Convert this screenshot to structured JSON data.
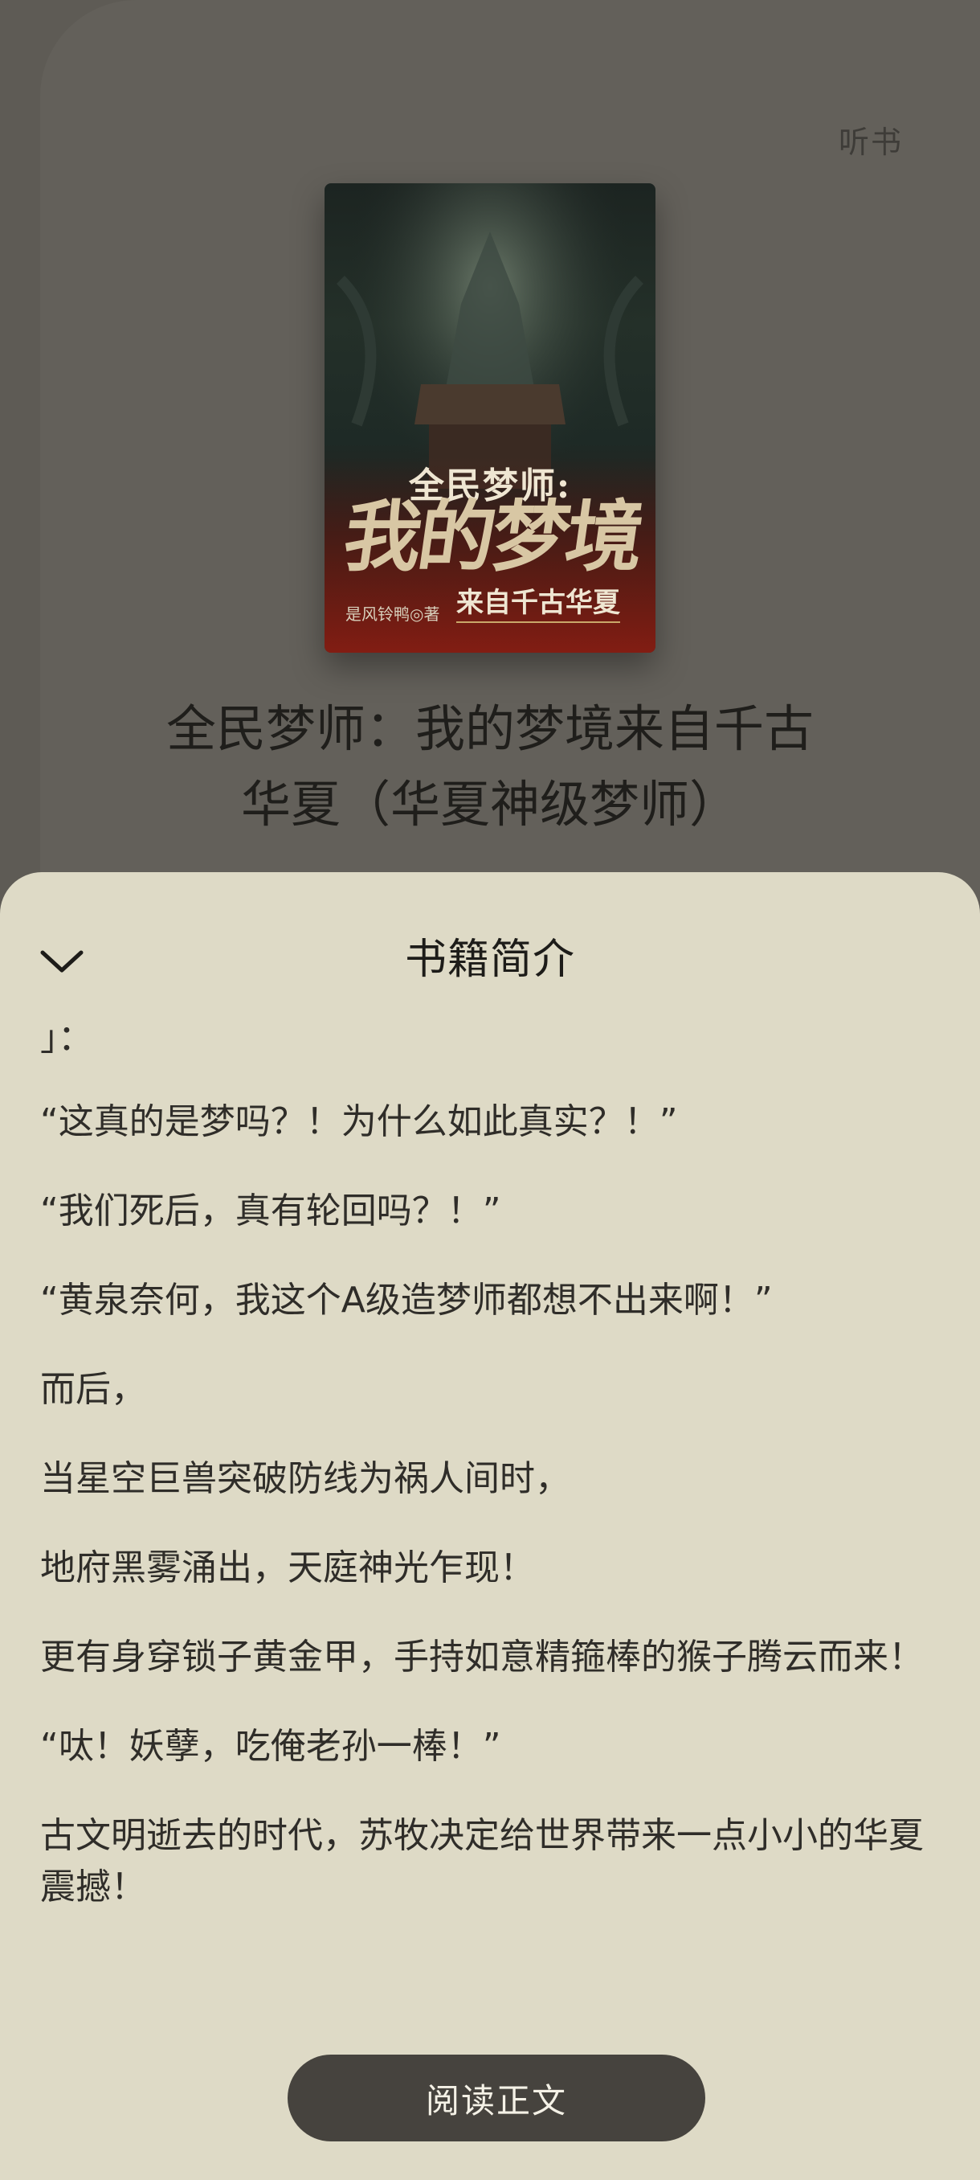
{
  "background": {
    "listen_label": "听书",
    "cover": {
      "subtitle": "全民梦师:",
      "main_title": "我的梦境",
      "tagline": "来自千古华夏",
      "author": "是风铃鸭◎著"
    },
    "book_title_line1": "全民梦师：我的梦境来自千古",
    "book_title_line2": "华夏（华夏神级梦师）"
  },
  "sheet": {
    "title": "书籍简介",
    "collapse_icon": "chevron-down-icon",
    "paragraphs": [
      "」：",
      "“这真的是梦吗？！为什么如此真实？！”",
      "“我们死后，真有轮回吗？！”",
      "“黄泉奈何，我这个A级造梦师都想不出来啊！”",
      "而后，",
      "当星空巨兽突破防线为祸人间时，",
      "地府黑雾涌出，天庭神光乍现！",
      "更有身穿锁子黄金甲，手持如意精箍棒的猴子腾云而来！",
      "“呔！妖孽，吃俺老孙一棒！”",
      "古文明逝去的时代，苏牧决定给世界带来一点小小的华夏震撼！"
    ],
    "read_button_label": "阅读正文"
  },
  "colors": {
    "sheet_bg": "#dedac6",
    "overlay_bg": "#5e5b55",
    "button_bg": "#46433e",
    "button_text": "#f4f1e6"
  }
}
